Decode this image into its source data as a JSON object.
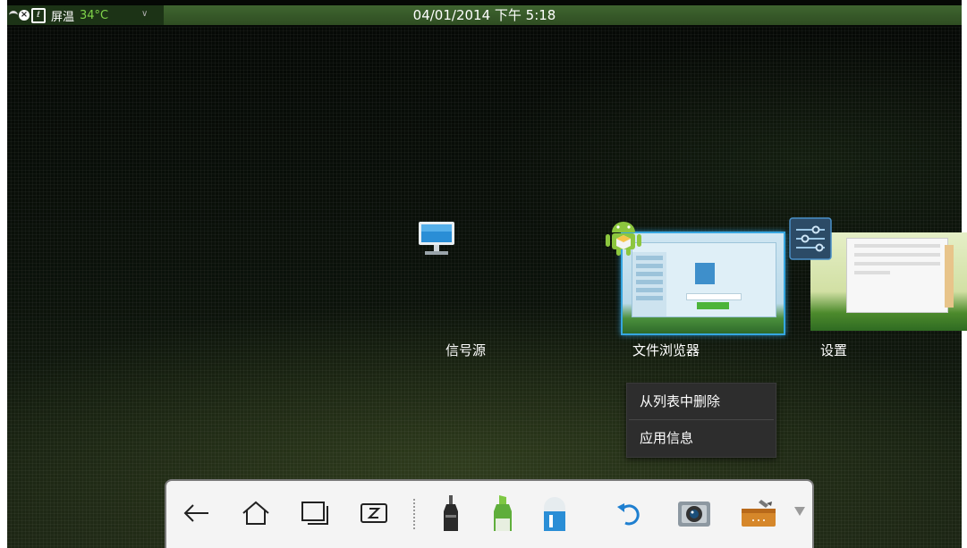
{
  "status_bar": {
    "screen_temp_label": "屏温",
    "screen_temp_value": "34°C",
    "datetime": "04/01/2014 下午 5:18"
  },
  "recent_apps": [
    {
      "label": "信号源",
      "icon": "monitor-icon"
    },
    {
      "label": "文件浏览器",
      "icon": "android-icon"
    },
    {
      "label": "设置",
      "icon": "settings-sliders-icon"
    }
  ],
  "context_menu": {
    "items": [
      {
        "label": "从列表中删除"
      },
      {
        "label": "应用信息"
      }
    ]
  },
  "toolbar": {
    "buttons": [
      {
        "icon": "back-arrow-icon"
      },
      {
        "icon": "home-icon"
      },
      {
        "icon": "recent-apps-icon"
      },
      {
        "icon": "z-icon"
      },
      {
        "icon": "black-marker-icon"
      },
      {
        "icon": "green-highlighter-icon"
      },
      {
        "icon": "eraser-icon"
      },
      {
        "icon": "undo-icon"
      },
      {
        "icon": "camera-icon"
      },
      {
        "icon": "toolbox-icon"
      },
      {
        "icon": "dropdown-arrow-icon"
      }
    ]
  },
  "colors": {
    "status_bar_bg": "#3a5a2a",
    "temp_text": "#7fd44a",
    "thumb_highlight": "#36a6e0",
    "menu_bg": "#2d2d2d",
    "toolbar_bg": "#f4f4f4"
  }
}
